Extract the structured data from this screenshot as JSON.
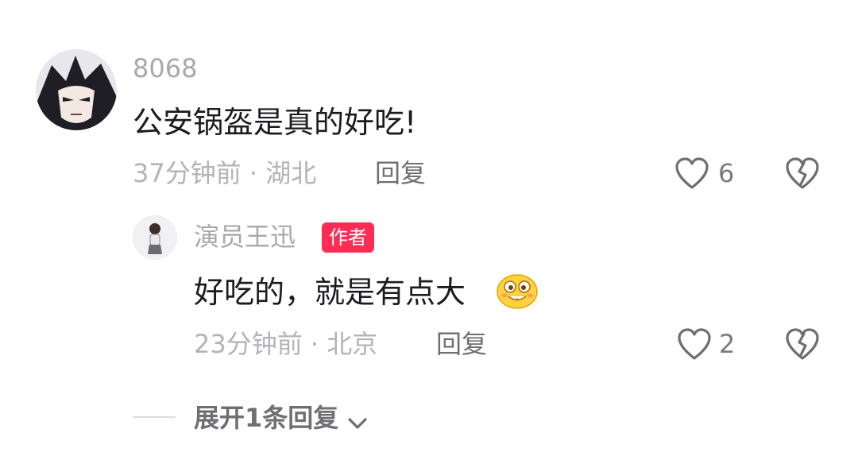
{
  "comment": {
    "username": "8068",
    "text": "公安锅盔是真的好吃!",
    "time": "37分钟前",
    "separator": "·",
    "location": "湖北",
    "reply_label": "回复",
    "likes": "6",
    "like_icon": "heart-outline-icon",
    "dislike_icon": "broken-heart-icon"
  },
  "reply": {
    "username": "演员王迅",
    "badge": "作者",
    "badge_color": "#fe2c55",
    "text": "好吃的，就是有点大",
    "emoji": "grinning-emoji",
    "time": "23分钟前",
    "separator": "·",
    "location": "北京",
    "reply_label": "回复",
    "likes": "2",
    "like_icon": "heart-outline-icon",
    "dislike_icon": "broken-heart-icon"
  },
  "expand": {
    "label": "展开1条回复",
    "icon": "chevron-down-icon"
  }
}
